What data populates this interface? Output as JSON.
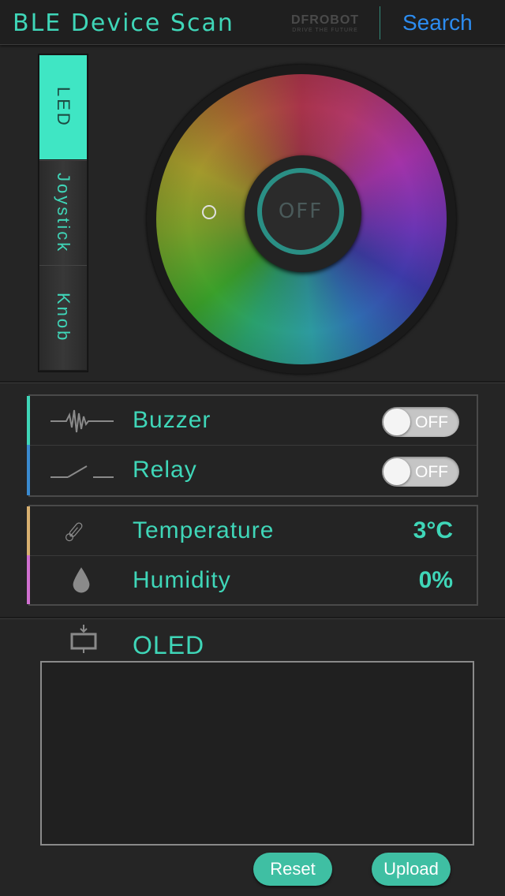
{
  "header": {
    "title": "BLE Device Scan",
    "logo_text": "DFROBOT",
    "logo_tagline": "DRIVE THE FUTURE",
    "search_label": "Search"
  },
  "tabs": [
    {
      "label": "LED",
      "active": true
    },
    {
      "label": "Joystick",
      "active": false
    },
    {
      "label": "Knob",
      "active": false
    }
  ],
  "led": {
    "power_label": "OFF"
  },
  "outputs": [
    {
      "label": "Buzzer",
      "icon": "waveform-icon",
      "toggle": "OFF"
    },
    {
      "label": "Relay",
      "icon": "switch-icon",
      "toggle": "OFF"
    }
  ],
  "sensors": [
    {
      "label": "Temperature",
      "icon": "thermometer-icon",
      "value": "3°C"
    },
    {
      "label": "Humidity",
      "icon": "droplet-icon",
      "value": "0%"
    }
  ],
  "oled": {
    "label": "OLED",
    "text": "",
    "reset_label": "Reset",
    "upload_label": "Upload"
  },
  "colors": {
    "accent": "#3fd6b8",
    "search": "#2c8cf0",
    "background": "#252525"
  }
}
